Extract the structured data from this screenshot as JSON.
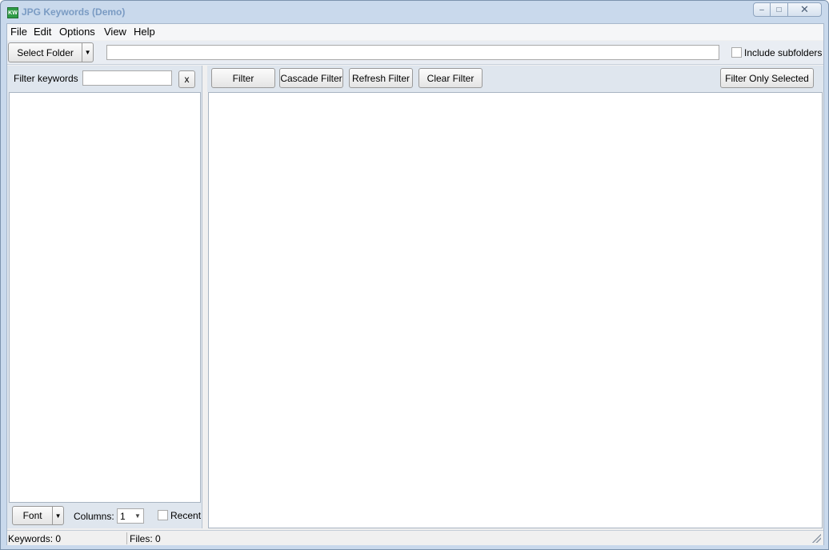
{
  "window": {
    "title": "JPG Keywords (Demo)",
    "icon_text": "KW",
    "controls": {
      "minimize": "–",
      "maximize": "□",
      "close": "✕"
    }
  },
  "menu": [
    {
      "label": "File"
    },
    {
      "label": "Edit"
    },
    {
      "label": "Options"
    },
    {
      "label": "View"
    },
    {
      "label": "Help"
    }
  ],
  "toolbar": {
    "select_folder_label": "Select Folder",
    "path_value": "",
    "include_subfolders_label": "Include subfolders",
    "include_subfolders_checked": false
  },
  "left": {
    "filter_keywords_label": "Filter keywords",
    "filter_value": "",
    "clear_label": "x",
    "font_label": "Font",
    "columns_label": "Columns:",
    "columns_value": "1",
    "recent_label": "Recent",
    "recent_checked": false
  },
  "filters": {
    "filter_label": "Filter",
    "cascade_label": "Cascade Filter",
    "refresh_label": "Refresh Filter",
    "clear_label": "Clear Filter",
    "only_selected_label": "Filter Only Selected"
  },
  "status": {
    "keywords": "Keywords: 0",
    "files": "Files: 0"
  },
  "icons": {
    "dropdown": "▼"
  }
}
